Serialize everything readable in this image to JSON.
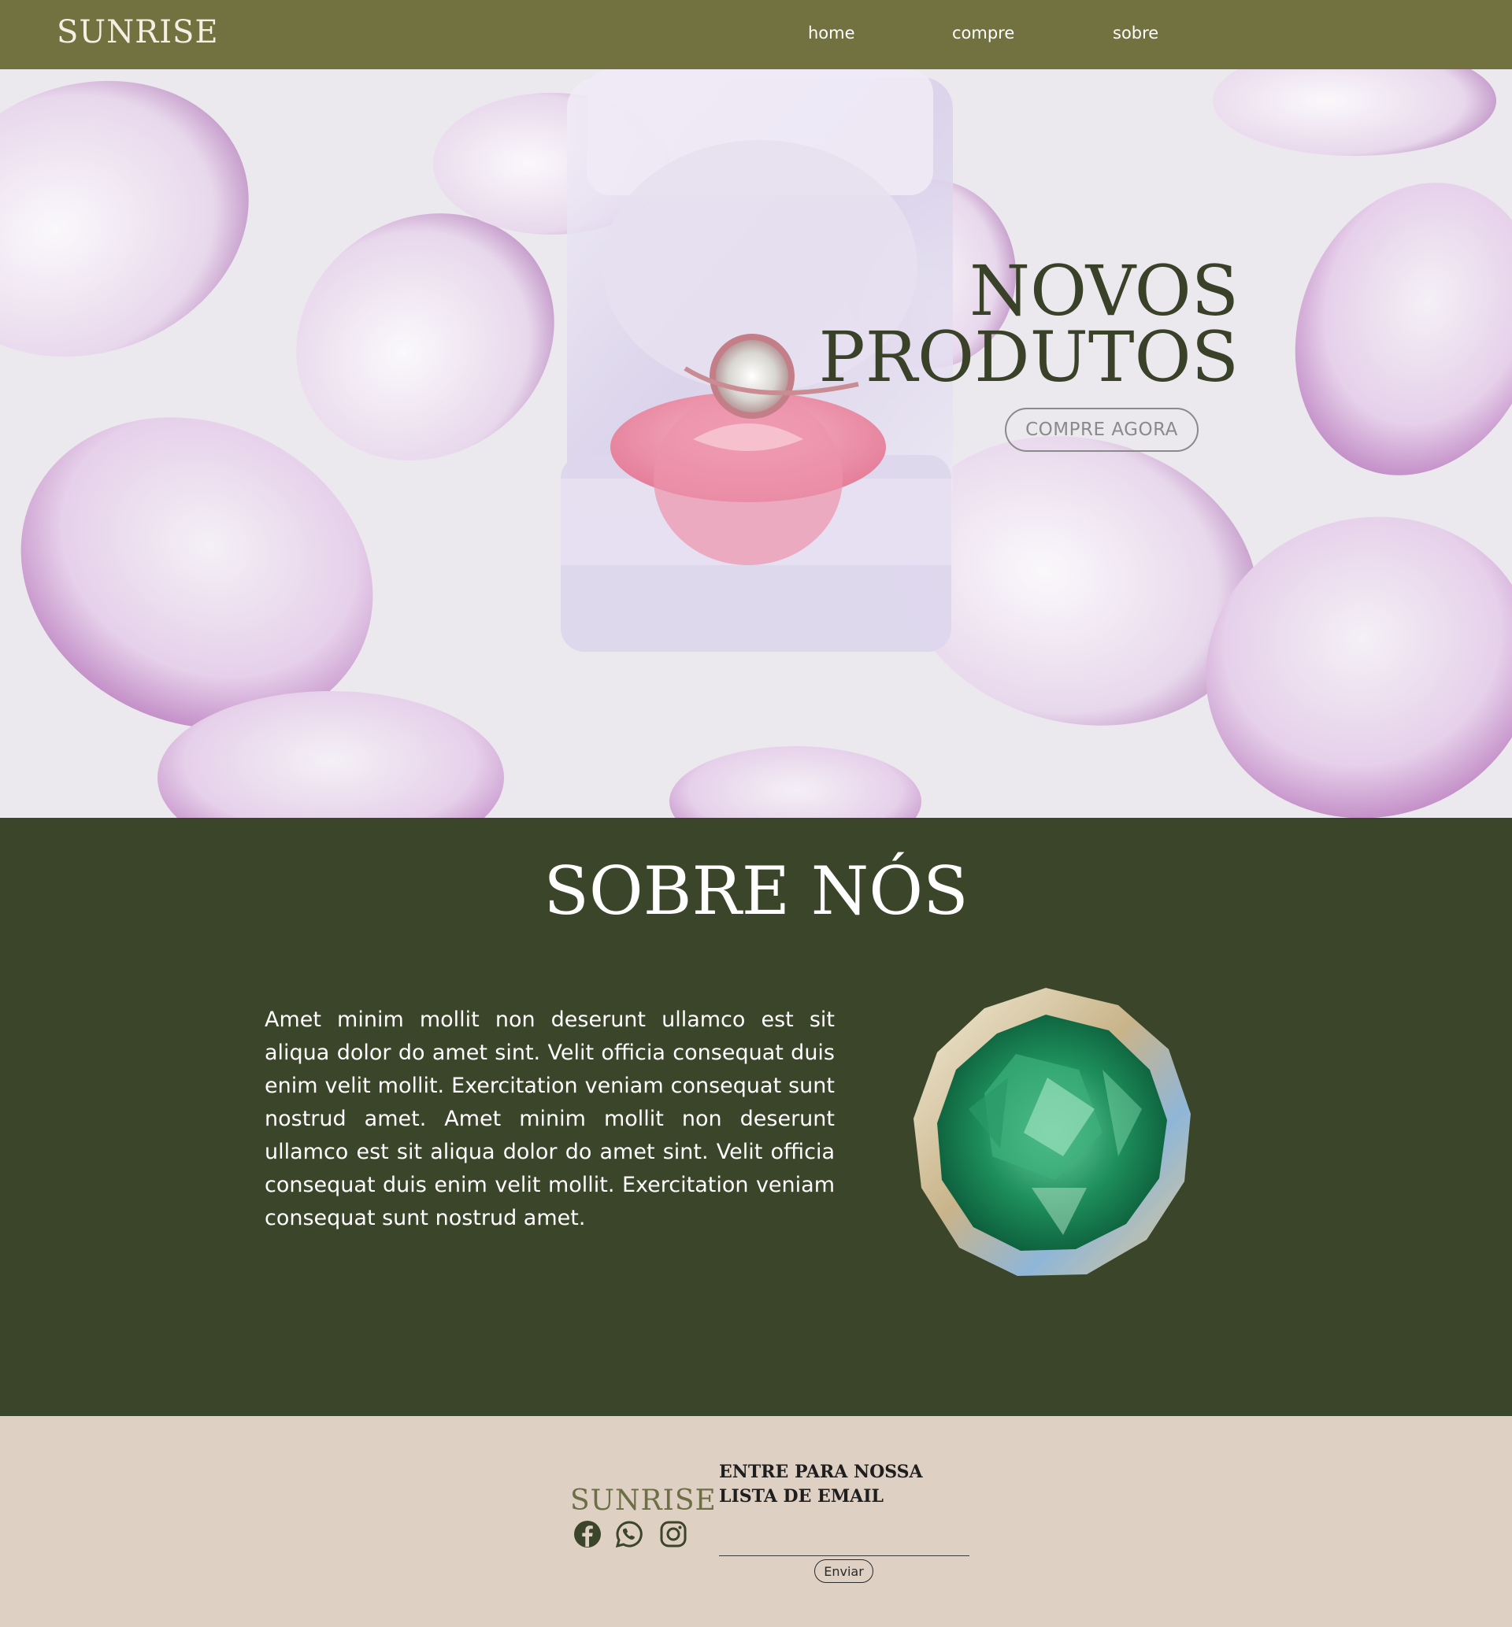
{
  "nav": {
    "logo": "SUNRISE",
    "links": [
      "home",
      "compre",
      "sobre"
    ]
  },
  "hero": {
    "title_line1": "NOVOS",
    "title_line2": "PRODUTOS",
    "cta_label": "COMPRE AGORA"
  },
  "about": {
    "title": "SOBRE NÓS",
    "body": "Amet minim mollit non deserunt ullamco est sit aliqua dolor do amet sint. Velit officia consequat duis enim velit mollit. Exercitation veniam consequat sunt nostrud amet. Amet minim mollit non deserunt ullamco est sit aliqua dolor do amet sint. Velit officia consequat duis enim velit mollit. Exercitation veniam consequat sunt nostrud amet."
  },
  "footer": {
    "logo": "SUNRISE",
    "newsletter_title": "ENTRE PARA NOSSA LISTA DE EMAIL",
    "email_placeholder": "",
    "send_label": "Enviar",
    "social": [
      "facebook-icon",
      "whatsapp-icon",
      "instagram-icon"
    ]
  },
  "colors": {
    "nav_bg": "#727240",
    "about_bg": "#3b4529",
    "footer_bg": "#dfd0c4",
    "hero_title": "#3a4129"
  }
}
